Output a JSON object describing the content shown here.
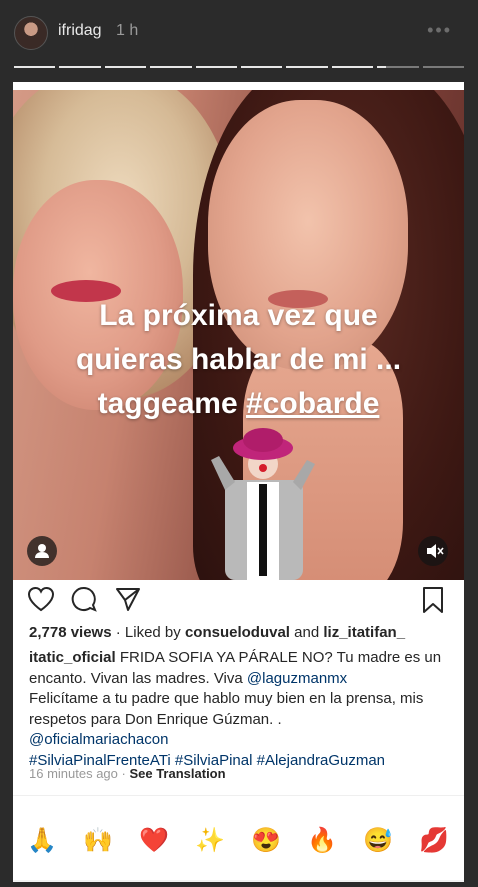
{
  "story": {
    "username": "ifridag",
    "time": "1 h",
    "more_icon": "more-horizontal-icon"
  },
  "post": {
    "overlay_lines": [
      "La próxima vez que",
      "quieras hablar de mi ...",
      "taggeame "
    ],
    "overlay_hashtag": "#cobarde",
    "views": "2,778 views",
    "liked_by_prefix": " · Liked by ",
    "liker1": "consueloduval",
    "and": " and ",
    "liker2": "liz_itatifan_",
    "caption_user": "itatic_oficial",
    "caption_text1": " FRIDA SOFIA YA PÁRALE NO? Tu madre es un encanto. Vivan las madres. Viva ",
    "mention1": "@laguzmanmx",
    "caption_text2": "Felicítame a tu padre que hablo muy bien en la prensa, mis respetos para Don Enrique Gúzman. .",
    "mention2": "@oficialmariachacon",
    "hashtags": "#SilviaPinalFrenteATi #SilviaPinal #AlejandraGuzman",
    "timestamp": "16 minutes ago",
    "translation": "See Translation"
  },
  "reactions": [
    "🙏",
    "🙌",
    "❤️",
    "✨",
    "😍",
    "🔥",
    "😅",
    "💋"
  ],
  "colors": {
    "background": "#2b2b2b",
    "link": "#003569"
  }
}
